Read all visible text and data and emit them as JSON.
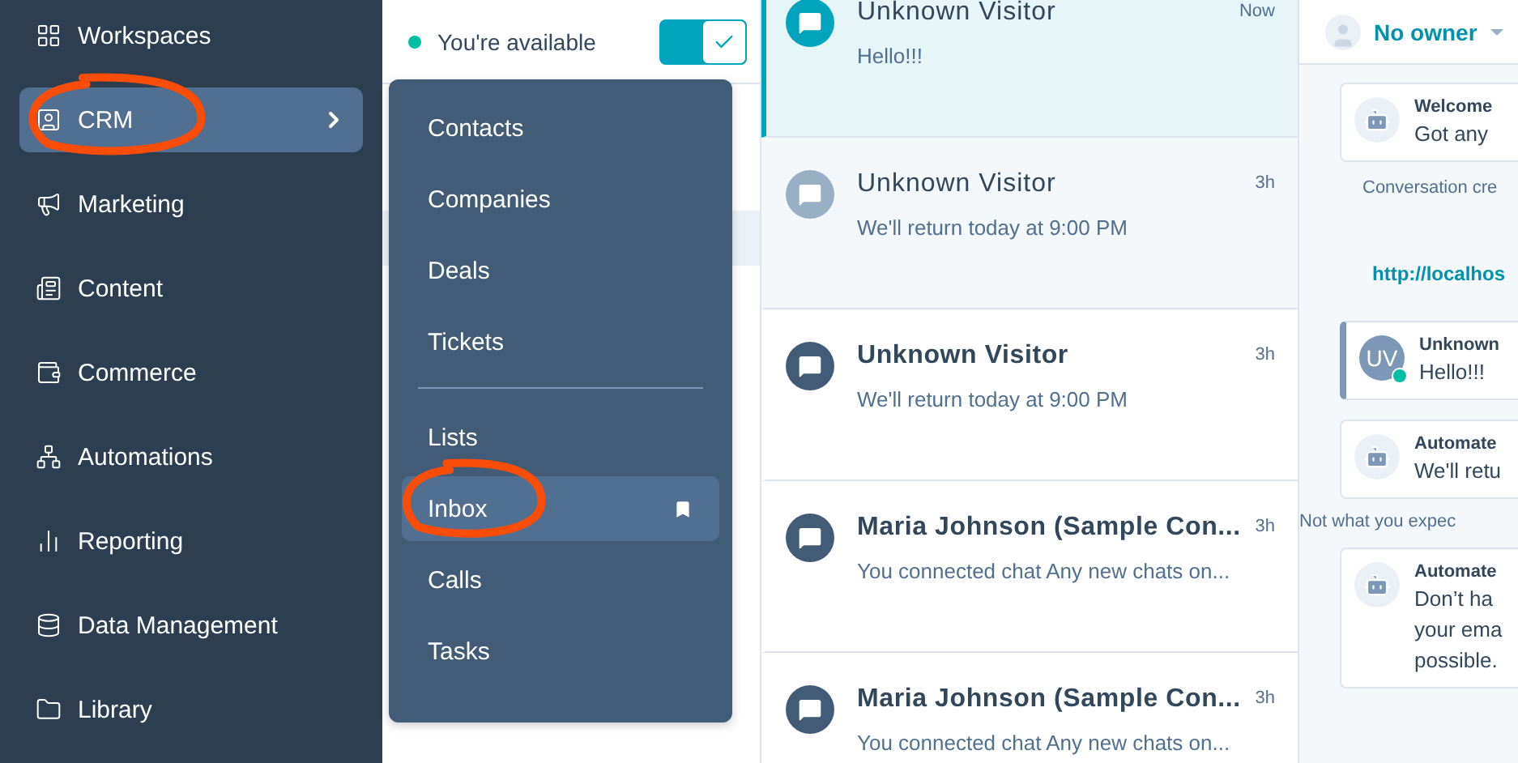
{
  "sidebar": {
    "items": [
      {
        "label": "Workspaces",
        "selected": false,
        "has_submenu": false,
        "circled": false
      },
      {
        "label": "CRM",
        "selected": true,
        "has_submenu": true,
        "circled": true
      },
      {
        "label": "Marketing",
        "selected": false,
        "has_submenu": false,
        "circled": false
      },
      {
        "label": "Content",
        "selected": false,
        "has_submenu": false,
        "circled": false
      },
      {
        "label": "Commerce",
        "selected": false,
        "has_submenu": false,
        "circled": false
      },
      {
        "label": "Automations",
        "selected": false,
        "has_submenu": false,
        "circled": false
      },
      {
        "label": "Reporting",
        "selected": false,
        "has_submenu": false,
        "circled": false
      },
      {
        "label": "Data Management",
        "selected": false,
        "has_submenu": false,
        "circled": false
      },
      {
        "label": "Library",
        "selected": false,
        "has_submenu": false,
        "circled": false
      }
    ]
  },
  "availability": {
    "label": "You're available",
    "on": true
  },
  "submenu": {
    "groups": [
      [
        {
          "label": "Contacts",
          "selected": false,
          "bookmarked": false,
          "circled": false
        },
        {
          "label": "Companies",
          "selected": false,
          "bookmarked": false,
          "circled": false
        },
        {
          "label": "Deals",
          "selected": false,
          "bookmarked": false,
          "circled": false
        },
        {
          "label": "Tickets",
          "selected": false,
          "bookmarked": false,
          "circled": false
        }
      ],
      [
        {
          "label": "Lists",
          "selected": false,
          "bookmarked": false,
          "circled": false
        },
        {
          "label": "Inbox",
          "selected": true,
          "bookmarked": true,
          "circled": true
        },
        {
          "label": "Calls",
          "selected": false,
          "bookmarked": false,
          "circled": false
        },
        {
          "label": "Tasks",
          "selected": false,
          "bookmarked": false,
          "circled": false
        }
      ]
    ]
  },
  "conversations": [
    {
      "name": "Unknown Visitor",
      "preview": "Hello!!!",
      "time": "Now",
      "selected": true,
      "unread": false
    },
    {
      "name": "Unknown Visitor",
      "preview": "We'll return today at 9:00 PM",
      "time": "3h",
      "selected": false,
      "unread": false
    },
    {
      "name": "Unknown Visitor",
      "preview": "We'll return today at 9:00 PM",
      "time": "3h",
      "selected": false,
      "unread": true
    },
    {
      "name": "Maria Johnson (Sample Con...",
      "preview": "You connected chat Any new chats on...",
      "time": "3h",
      "selected": false,
      "unread": true
    },
    {
      "name": "Maria Johnson (Sample Con...",
      "preview": "You connected chat Any new chats on...",
      "time": "3h",
      "selected": false,
      "unread": true
    }
  ],
  "thread": {
    "owner": "No owner",
    "messages": [
      {
        "kind": "bot",
        "title": "Welcome",
        "lines": [
          "Got any"
        ]
      },
      {
        "kind": "note",
        "text": "Conversation cre"
      },
      {
        "kind": "link",
        "text": "http://localhos"
      },
      {
        "kind": "visitor",
        "title": "Unknown",
        "initials": "UV",
        "online": true,
        "lines": [
          "Hello!!!"
        ]
      },
      {
        "kind": "bot",
        "title": "Automate",
        "lines": [
          "We'll retu"
        ]
      },
      {
        "kind": "note",
        "text": "Not what you expec"
      },
      {
        "kind": "bot",
        "title": "Automate",
        "lines": [
          "Don’t ha",
          "your ema",
          "possible."
        ]
      }
    ]
  }
}
